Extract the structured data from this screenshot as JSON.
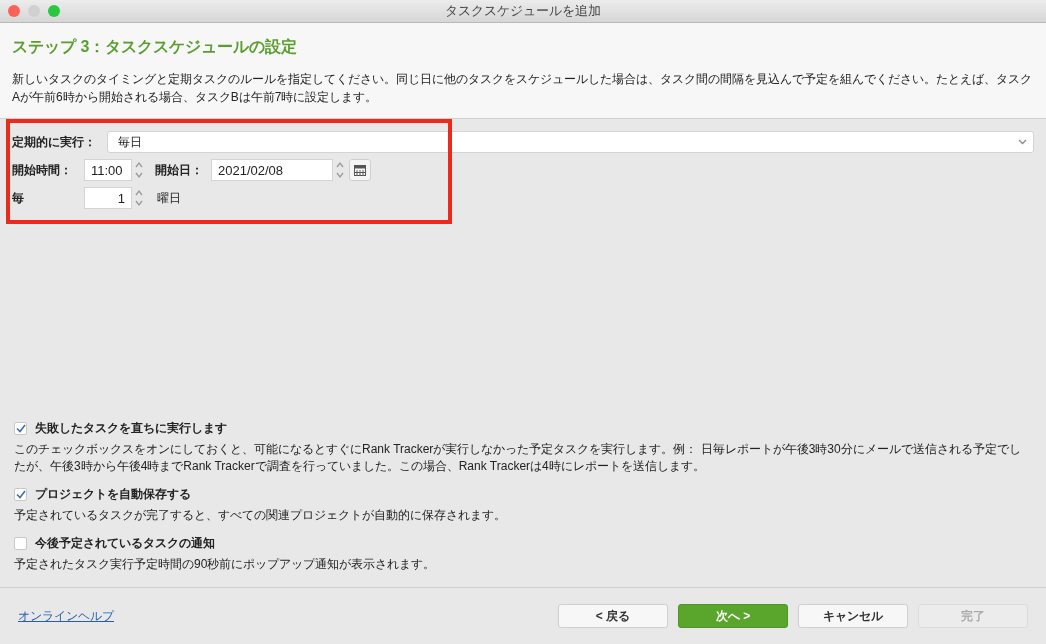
{
  "window": {
    "title": "タスクスケジュールを追加"
  },
  "header": {
    "title": "ステップ 3：タスクスケジュールの設定",
    "description": "新しいタスクのタイミングと定期タスクのルールを指定してください。同じ日に他のタスクをスケジュールした場合は、タスク間の間隔を見込んで予定を組んでください。たとえば、タスクAが午前6時から開始される場合、タスクBは午前7時に設定します。"
  },
  "schedule": {
    "repeat_label": "定期的に実行：",
    "repeat_value": "毎日",
    "start_time_label": "開始時間：",
    "start_time": "11:00",
    "start_date_label": "開始日：",
    "start_date": "2021/02/08",
    "every_label": "毎",
    "every_value": "1",
    "every_unit": "曜日"
  },
  "options": [
    {
      "label": "失敗したタスクを直ちに実行します",
      "checked": true,
      "description": "このチェックボックスをオンにしておくと、可能になるとすぐにRank Trackerが実行しなかった予定タスクを実行します。例： 日毎レポートが午後3時30分にメールで送信される予定でしたが、午後3時から午後4時までRank Trackerで調査を行っていました。この場合、Rank Trackerは4時にレポートを送信します。"
    },
    {
      "label": "プロジェクトを自動保存する",
      "checked": true,
      "description": "予定されているタスクが完了すると、すべての関連プロジェクトが自動的に保存されます。"
    },
    {
      "label": "今後予定されているタスクの通知",
      "checked": false,
      "description": "予定されたタスク実行予定時間の90秒前にポップアップ通知が表示されます。"
    }
  ],
  "footer": {
    "help_link": "オンラインヘルプ",
    "buttons": [
      {
        "label": "< 戻る",
        "kind": "default",
        "disabled": false
      },
      {
        "label": "次へ >",
        "kind": "primary",
        "disabled": false
      },
      {
        "label": "キャンセル",
        "kind": "default",
        "disabled": false
      },
      {
        "label": "完了",
        "kind": "default",
        "disabled": true
      }
    ]
  }
}
